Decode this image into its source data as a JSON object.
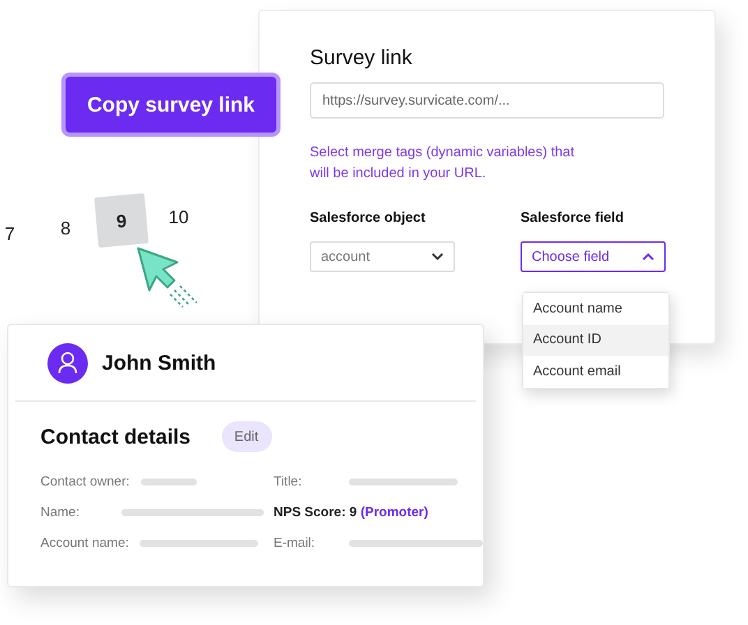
{
  "copy_button": {
    "label": "Copy survey link"
  },
  "rating_scale": {
    "options": [
      {
        "label": "7",
        "selected": false
      },
      {
        "label": "8",
        "selected": false
      },
      {
        "label": "9",
        "selected": true
      },
      {
        "label": "10",
        "selected": false
      }
    ]
  },
  "survey_link": {
    "title": "Survey link",
    "url_field": {
      "placeholder": "https://survey.survicate.com/..."
    },
    "helper_text": "Select merge tags (dynamic variables) that will be included in your URL.",
    "object_select": {
      "label": "Salesforce object",
      "value": "account",
      "expanded": false
    },
    "field_select": {
      "label": "Salesforce field",
      "placeholder": "Choose field",
      "expanded": true,
      "options": [
        {
          "label": "Account name",
          "selected": false
        },
        {
          "label": "Account ID",
          "selected": true
        },
        {
          "label": "Account email",
          "selected": false
        }
      ]
    }
  },
  "contact_card": {
    "name": "John Smith",
    "section_title": "Contact details",
    "edit_button": "Edit",
    "details": [
      {
        "kind": "blank",
        "label": "Contact owner:"
      },
      {
        "kind": "blank",
        "label": "Title:"
      },
      {
        "kind": "blank",
        "label": "Name:"
      },
      {
        "kind": "score",
        "label": "NPS Score: 9",
        "note": "(Promoter)"
      },
      {
        "kind": "blank",
        "label": "Account name:"
      },
      {
        "kind": "blank",
        "label": "E-mail:"
      }
    ]
  }
}
